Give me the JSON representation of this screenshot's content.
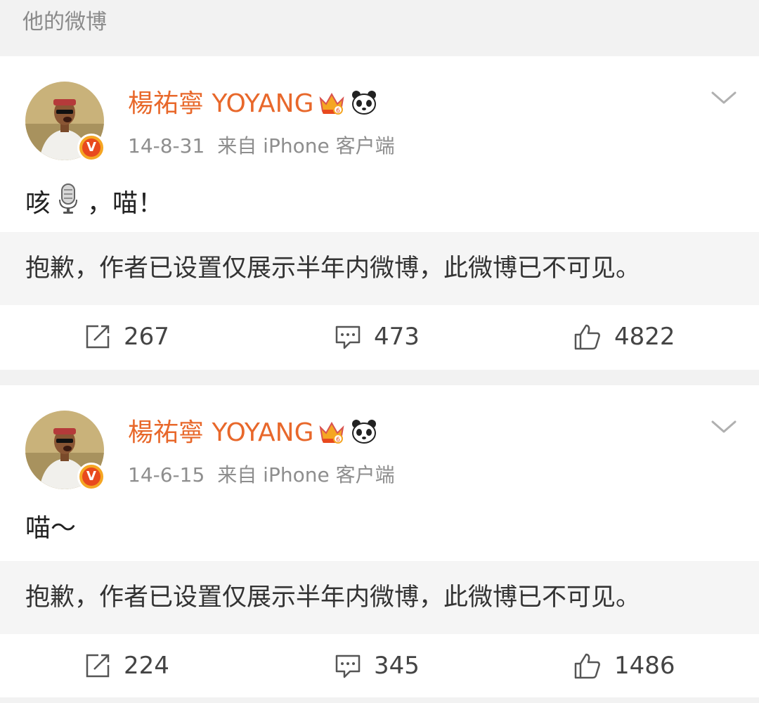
{
  "section": {
    "title": "他的微博"
  },
  "posts": [
    {
      "user": {
        "name": "楊祐寧 YOYANG"
      },
      "date": "14-8-31",
      "source": "来自 iPhone 客户端",
      "text_before": "咳",
      "text_after": "，喵！",
      "notice": "抱歉，作者已设置仅展示半年内微博，此微博已不可见。",
      "stats": {
        "reposts": "267",
        "comments": "473",
        "likes": "4822"
      }
    },
    {
      "user": {
        "name": "楊祐寧 YOYANG"
      },
      "date": "14-6-15",
      "source": "来自 iPhone 客户端",
      "text": "喵～",
      "notice": "抱歉，作者已设置仅展示半年内微博，此微博已不可见。",
      "stats": {
        "reposts": "224",
        "comments": "345",
        "likes": "1486"
      }
    }
  ],
  "icons": {
    "verified": "verified-v-badge",
    "crown": "crown-icon",
    "panda": "panda-icon",
    "more": "chevron-down-icon",
    "repost": "repost-icon",
    "comment": "comment-icon",
    "like": "like-icon",
    "microphone": "microphone-emoji"
  },
  "colors": {
    "username": "#e8682b",
    "meta": "#8e8e8e",
    "background": "#f2f2f2",
    "notice_bg": "#f5f5f5"
  }
}
